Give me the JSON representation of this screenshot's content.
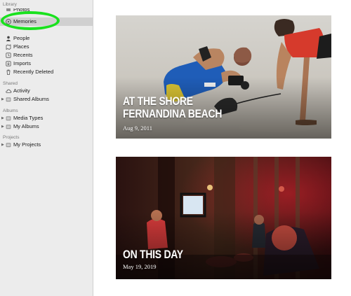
{
  "sidebar": {
    "library_header": "Library",
    "library_items": [
      {
        "label": "Photos",
        "icon": "photos-icon"
      },
      {
        "label": "Memories",
        "icon": "memories-icon"
      },
      {
        "label": "People",
        "icon": "people-icon"
      },
      {
        "label": "Places",
        "icon": "places-icon"
      },
      {
        "label": "Recents",
        "icon": "recents-icon"
      },
      {
        "label": "Imports",
        "icon": "imports-icon"
      },
      {
        "label": "Recently Deleted",
        "icon": "trash-icon"
      }
    ],
    "shared_header": "Shared",
    "shared_items": [
      {
        "label": "Activity",
        "icon": "cloud-icon"
      },
      {
        "label": "Shared Albums",
        "icon": "folder-icon"
      }
    ],
    "albums_header": "Albums",
    "albums_items": [
      {
        "label": "Media Types",
        "icon": "folder-icon"
      },
      {
        "label": "My Albums",
        "icon": "folder-icon"
      }
    ],
    "projects_header": "Projects",
    "projects_items": [
      {
        "label": "My Projects",
        "icon": "folder-icon"
      }
    ],
    "selected": "Memories",
    "highlight_color": "#19e21e"
  },
  "memories": [
    {
      "title_line1": "AT THE SHORE",
      "title_line2": "FERNANDINA BEACH",
      "date": "Aug 9, 2011"
    },
    {
      "title_line1": "ON THIS DAY",
      "date": "May 19, 2019"
    }
  ]
}
